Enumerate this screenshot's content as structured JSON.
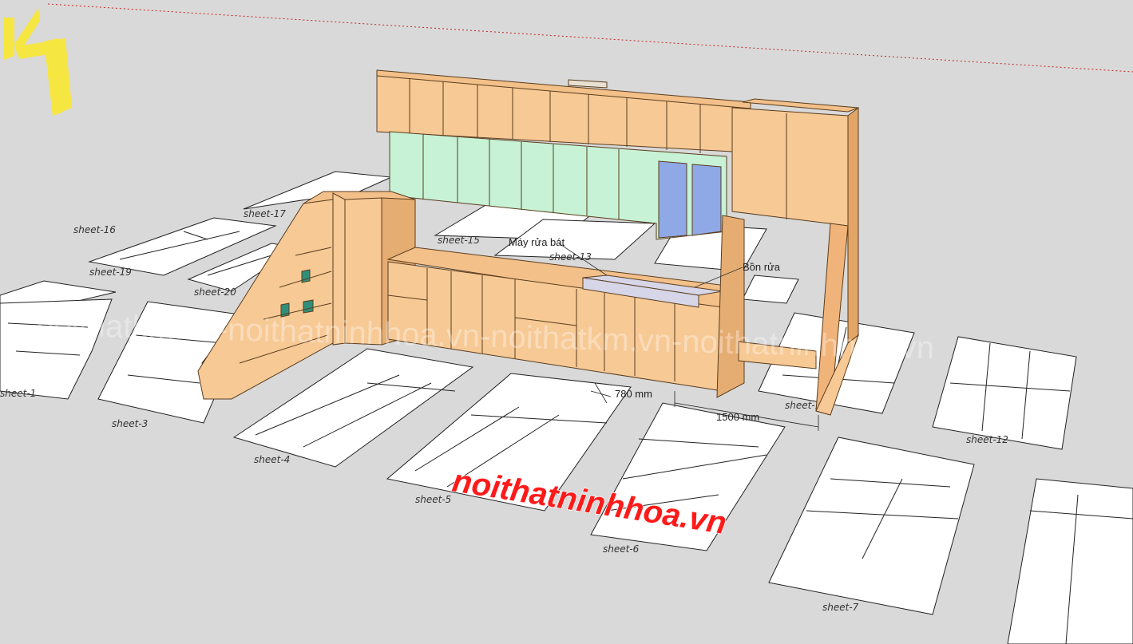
{
  "scene": {
    "logo_letters": "KM",
    "watermark": "noithatkm.vn-noithatninhhoa.vn-noithatkm.vn-noithatninhhoa.vn",
    "brand": "noithatninhhoa.vn",
    "colors": {
      "background": "#d9d9d9",
      "cabinet_wood": "#f7c995",
      "cabinet_edge": "#d9a268",
      "glass_green": "#c7f2d6",
      "glass_blue": "#8fa8e6",
      "sheet_fill": "#ffffff",
      "brand_red": "#ff1a1a",
      "logo_yellow": "#f5e642",
      "axis_red": "#cc2222"
    }
  },
  "callouts": {
    "dishwasher": "Máy rửa bát",
    "sink": "Bồn rửa"
  },
  "dimensions": {
    "depth": "780 mm",
    "width": "1500 mm"
  },
  "sheets": [
    {
      "label": "sheet-1"
    },
    {
      "label": "sheet-3"
    },
    {
      "label": "sheet-4"
    },
    {
      "label": "sheet-5"
    },
    {
      "label": "sheet-6"
    },
    {
      "label": "sheet-7"
    },
    {
      "label": "sheet-11"
    },
    {
      "label": "sheet-12"
    },
    {
      "label": "sheet-13"
    },
    {
      "label": "sheet-15"
    },
    {
      "label": "sheet-16"
    },
    {
      "label": "sheet-17"
    },
    {
      "label": "sheet-19"
    },
    {
      "label": "sheet-20"
    }
  ]
}
